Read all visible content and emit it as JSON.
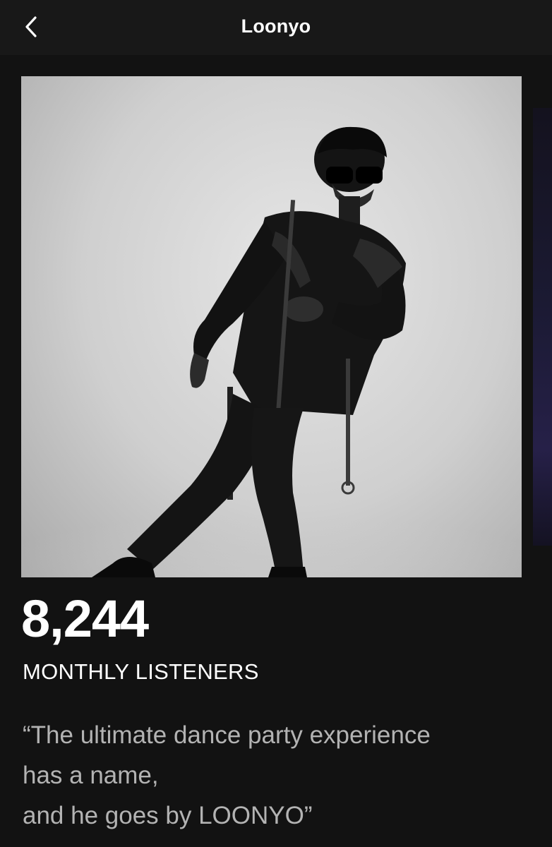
{
  "header": {
    "title": "Loonyo",
    "back_icon": "chevron-left-icon"
  },
  "artist": {
    "photo_description_icon": "artist-photo",
    "monthly_listeners": "8,244",
    "monthly_listeners_label": "MONTHLY LISTENERS",
    "bio_lines": [
      "“The ultimate dance party experience",
      "has a name,",
      "and he goes by LOONYO”"
    ]
  },
  "colors": {
    "background": "#121212",
    "header_background": "#181818",
    "text_primary": "#ffffff",
    "text_secondary": "#b3b3b3"
  }
}
